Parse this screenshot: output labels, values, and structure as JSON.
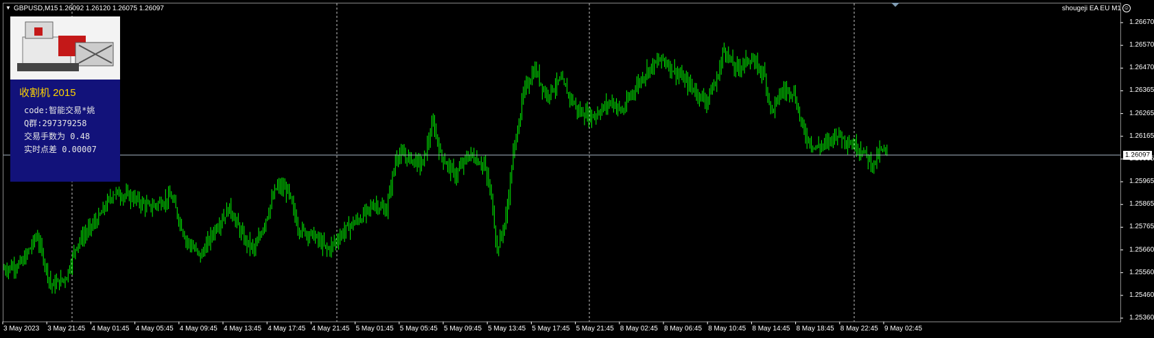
{
  "header": {
    "symbol": "GBPUSD,M15",
    "quotes": "1.26092 1.26120 1.26075 1.26097",
    "ea_label": "shougeji EA EU M1",
    "face_glyph": "☺"
  },
  "info_panel": {
    "title": "收割机  2015",
    "lines": [
      "code:智能交易*姚",
      "Q群:297379258",
      "交易手数为 0.48",
      "实时点差 0.00007"
    ]
  },
  "current_price": "1.26097",
  "colors": {
    "candles": "#00ff00",
    "grid": "#c8c8c8",
    "panel_bg": "#12127a",
    "title": "#ffd400",
    "price_line": "#a9b8c6"
  },
  "chart_data": {
    "type": "candlestick",
    "y_ticks": [
      "1.26670",
      "1.26570",
      "1.26470",
      "1.26365",
      "1.26265",
      "1.26165",
      "1.26065",
      "1.25965",
      "1.25865",
      "1.25765",
      "1.25660",
      "1.25560",
      "1.25460",
      "1.25360"
    ],
    "x_ticks": [
      "3 May 2023",
      "3 May 21:45",
      "4 May 01:45",
      "4 May 05:45",
      "4 May 09:45",
      "4 May 13:45",
      "4 May 17:45",
      "4 May 21:45",
      "5 May 01:45",
      "5 May 05:45",
      "5 May 09:45",
      "5 May 13:45",
      "5 May 17:45",
      "5 May 21:45",
      "8 May 02:45",
      "8 May 06:45",
      "8 May 10:45",
      "8 May 14:45",
      "8 May 18:45",
      "8 May 22:45",
      "9 May 02:45"
    ],
    "ylim": [
      1.2533,
      1.2672
    ],
    "close_path": [
      [
        0,
        1.2556
      ],
      [
        25,
        1.2559
      ],
      [
        45,
        1.2572
      ],
      [
        65,
        1.2548
      ],
      [
        85,
        1.2552
      ],
      [
        100,
        1.2568
      ],
      [
        130,
        1.258
      ],
      [
        150,
        1.2592
      ],
      [
        175,
        1.259
      ],
      [
        200,
        1.2585
      ],
      [
        230,
        1.259
      ],
      [
        250,
        1.257
      ],
      [
        270,
        1.2562
      ],
      [
        290,
        1.2575
      ],
      [
        310,
        1.2585
      ],
      [
        330,
        1.257
      ],
      [
        345,
        1.2565
      ],
      [
        360,
        1.258
      ],
      [
        375,
        1.2595
      ],
      [
        390,
        1.2593
      ],
      [
        405,
        1.2575
      ],
      [
        425,
        1.2572
      ],
      [
        445,
        1.2565
      ],
      [
        470,
        1.2575
      ],
      [
        490,
        1.258
      ],
      [
        510,
        1.2587
      ],
      [
        525,
        1.2583
      ],
      [
        540,
        1.261
      ],
      [
        560,
        1.2608
      ],
      [
        575,
        1.2605
      ],
      [
        590,
        1.2625
      ],
      [
        600,
        1.261
      ],
      [
        620,
        1.26
      ],
      [
        640,
        1.261
      ],
      [
        660,
        1.2605
      ],
      [
        670,
        1.259
      ],
      [
        678,
        1.2565
      ],
      [
        690,
        1.258
      ],
      [
        700,
        1.261
      ],
      [
        715,
        1.264
      ],
      [
        730,
        1.265
      ],
      [
        745,
        1.2638
      ],
      [
        765,
        1.2645
      ],
      [
        790,
        1.263
      ],
      [
        810,
        1.2628
      ],
      [
        835,
        1.2635
      ],
      [
        850,
        1.263
      ],
      [
        865,
        1.264
      ],
      [
        885,
        1.265
      ],
      [
        905,
        1.2655
      ],
      [
        920,
        1.265
      ],
      [
        935,
        1.2645
      ],
      [
        950,
        1.264
      ],
      [
        965,
        1.2635
      ],
      [
        980,
        1.2645
      ],
      [
        990,
        1.266
      ],
      [
        1005,
        1.265
      ],
      [
        1025,
        1.2655
      ],
      [
        1045,
        1.2648
      ],
      [
        1055,
        1.263
      ],
      [
        1070,
        1.264
      ],
      [
        1085,
        1.264
      ],
      [
        1100,
        1.262
      ],
      [
        1115,
        1.2613
      ],
      [
        1130,
        1.2615
      ],
      [
        1145,
        1.262
      ],
      [
        1165,
        1.2615
      ],
      [
        1180,
        1.2612
      ],
      [
        1195,
        1.2605
      ],
      [
        1205,
        1.2612
      ],
      [
        1215,
        1.261
      ]
    ],
    "current_price": 1.26097
  }
}
